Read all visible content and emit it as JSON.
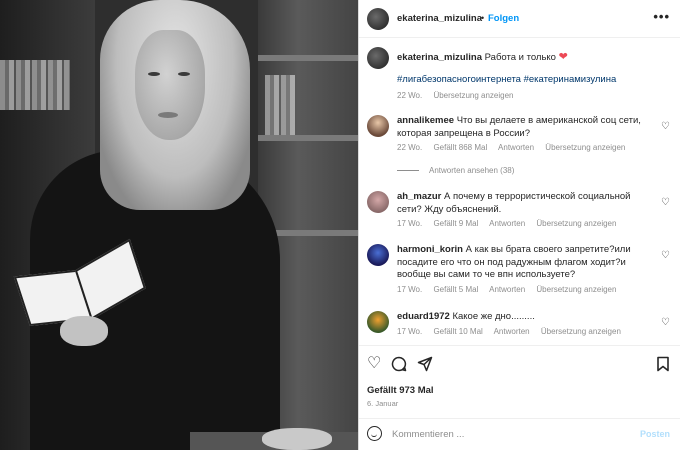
{
  "post": {
    "username": "ekaterina_mizulina",
    "separator": "•",
    "follow_label": "Folgen",
    "more_icon": "more-horizontal-icon",
    "caption": {
      "username": "ekaterina_mizulina",
      "text": "Работа и только",
      "emoji": "❤",
      "hashtags": "#лигабезопасногоинтернета #екатеринамизулина",
      "time": "22 Wo.",
      "translate": "Übersetzung anzeigen"
    }
  },
  "comments": [
    {
      "username": "annalikemee",
      "text": "Что вы делаете в американской соц сети, которая запрещена в России?",
      "time": "22 Wo.",
      "likes": "Gefällt 868 Mal",
      "reply": "Antworten",
      "translate": "Übersetzung anzeigen",
      "view_replies": "Antworten ansehen (38)"
    },
    {
      "username": "ah_mazur",
      "text": "А почему в террористической социальной сети? Жду объяснений.",
      "time": "17 Wo.",
      "likes": "Gefällt 9 Mal",
      "reply": "Antworten",
      "translate": "Übersetzung anzeigen"
    },
    {
      "username": "harmoni_korin",
      "text": "А как вы брата своего запретите?или посадите его что он под радужным флагом ходит?и вообще вы сами то че впн используете?",
      "time": "17 Wo.",
      "likes": "Gefällt 5 Mal",
      "reply": "Antworten",
      "translate": "Übersetzung anzeigen"
    },
    {
      "username": "eduard1972",
      "text": "Какое же дно.........",
      "time": "17 Wo.",
      "likes": "Gefällt 10 Mal",
      "reply": "Antworten",
      "translate": "Übersetzung anzeigen"
    }
  ],
  "actions": {
    "likes": "Gefällt 973 Mal",
    "date": "6. Januar"
  },
  "comment_box": {
    "placeholder": "Kommentieren ...",
    "post_label": "Posten"
  },
  "colors": {
    "link_blue": "#0095f6",
    "hashtag_blue": "#00376b",
    "meta_gray": "#8e8e8e",
    "heart_red": "#ed4956"
  }
}
